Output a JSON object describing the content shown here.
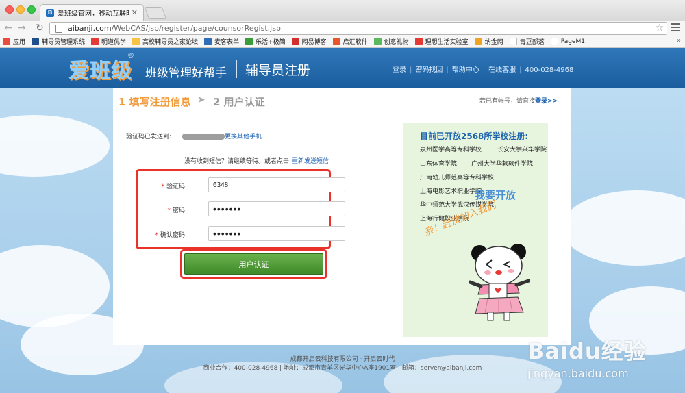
{
  "browser": {
    "tab_title": "爱班级官网，移动互联时代都",
    "tab_favicon": "B",
    "url_host": "aibanji.com",
    "url_path": "/WebCAS/jsp/register/page/counsorRegist.jsp",
    "bookmarks": [
      {
        "label": "应用",
        "color": "#e74c3c",
        "icon": "apps-grid-icon"
      },
      {
        "label": "辅导员管理系统",
        "color": "#1f4e8c",
        "icon": "site-icon"
      },
      {
        "label": "明道优学",
        "color": "#e53935",
        "icon": "site-icon"
      },
      {
        "label": "高校辅导员之家论坛",
        "color": "#f6c343",
        "icon": "site-icon"
      },
      {
        "label": "麦客表单",
        "color": "#2d6db5",
        "icon": "site-icon"
      },
      {
        "label": "乐活+极简",
        "color": "#3a9b3a",
        "icon": "site-icon"
      },
      {
        "label": "网易博客",
        "color": "#d32f2f",
        "icon": "site-icon"
      },
      {
        "label": "启汇软件",
        "color": "#e8542b",
        "icon": "site-icon"
      },
      {
        "label": "创意礼物",
        "color": "#5cb85c",
        "icon": "site-icon"
      },
      {
        "label": "理想生活实验室",
        "color": "#e53935",
        "icon": "site-icon"
      },
      {
        "label": "纳金网",
        "color": "#f1a424",
        "icon": "site-icon"
      },
      {
        "label": "青豆部落",
        "color": "#bdbdbd",
        "icon": "page-icon"
      },
      {
        "label": "PageM1",
        "color": "#bdbdbd",
        "icon": "page-icon"
      }
    ]
  },
  "header": {
    "logo_text": "爱班级",
    "logo_mark": "®",
    "slogan": "班级管理好帮手",
    "page_title": "辅导员注册",
    "links": {
      "login": "登录",
      "recover": "密码找回",
      "help": "帮助中心",
      "service": "在线客服",
      "phone": "400-028-4968"
    }
  },
  "steps": {
    "step1": "1 填写注册信息",
    "step2": "2  用户认证",
    "login_prompt": "若已有帐号，请直接",
    "login_link": "登录>>"
  },
  "form": {
    "sent_label": "验证码已发送到:",
    "change_phone": "更换其他手机",
    "no_sms_text": "没有收到短信？请继续等待。或者点击",
    "resend_link": "重新发送短信",
    "required_mark": "*",
    "code_label": "验证码:",
    "code_value": "6348",
    "password_label": "密码:",
    "password_value": "•••••••",
    "confirm_label": "确认密码:",
    "confirm_value": "•••••••",
    "submit_label": "用户认证"
  },
  "promo": {
    "title": "目前已开放2568所学校注册:",
    "schools": [
      "泉州医学高等专科学校",
      "长安大学兴华学院",
      "山东体育学院",
      "广州大学华软软件学院",
      "川南幼儿师范高等专科学校",
      "上海电影艺术职业学院",
      "华中师范大学武汉传媒学院",
      "上海行健职业学院"
    ],
    "open_text": "我要开放",
    "handwriting": "亲！赶快加入我们"
  },
  "footer": {
    "company": "成都开启云科技有限公司 · 开启云时代",
    "contact": "商业合作：400-028-4968  |  地址：成都市青羊区光华中心A座1901室  |  邮箱：server@aibanji.com"
  },
  "watermark": {
    "brand": "Baidu经验",
    "site": "jingyan.baidu.com"
  }
}
